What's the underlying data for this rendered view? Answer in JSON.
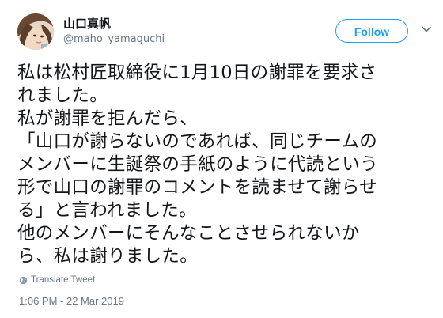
{
  "user": {
    "display_name": "山口真帆",
    "screen_name": "@maho_yamaguchi",
    "avatar": "avatar-photo"
  },
  "header": {
    "follow_label": "Follow",
    "caret_icon": "chevron-down-icon"
  },
  "tweet": {
    "lines": [
      "私は松村匠取締役に1月10日の謝罪を要求さ",
      "れました。",
      "私が謝罪を拒んだら、",
      "「山口が謝らないのであれば、同じチームの",
      "メンバーに生誕祭の手紙のように代読という",
      "形で山口の謝罪のコメントを読ませて謝らせ",
      "る」と言われました。",
      "他のメンバーにそんなことさせられないか",
      "ら、私は謝りました。"
    ]
  },
  "footer": {
    "translate_label": "Translate Tweet",
    "translate_icon": "globe-icon",
    "timestamp": "1:06 PM - 22 Mar 2019"
  },
  "colors": {
    "accent": "#1da1f2",
    "text": "#14171a",
    "secondary": "#657786"
  }
}
